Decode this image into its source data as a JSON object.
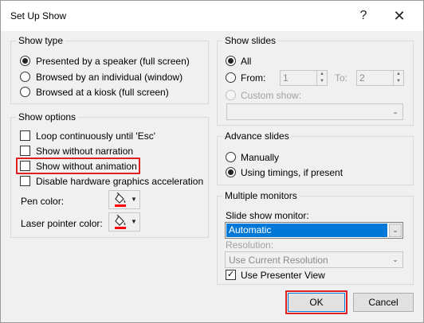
{
  "window": {
    "title": "Set Up Show",
    "help_glyph": "?",
    "close_glyph": "✕"
  },
  "show_type": {
    "title": "Show type",
    "options": [
      {
        "label": "Presented by a speaker (full screen)",
        "selected": true
      },
      {
        "label": "Browsed by an individual (window)",
        "selected": false
      },
      {
        "label": "Browsed at a kiosk (full screen)",
        "selected": false
      }
    ]
  },
  "show_options": {
    "title": "Show options",
    "checkboxes": [
      {
        "label": "Loop continuously until 'Esc'",
        "checked": false
      },
      {
        "label": "Show without narration",
        "checked": false
      },
      {
        "label": "Show without animation",
        "checked": false,
        "highlighted": true
      },
      {
        "label": "Disable hardware graphics acceleration",
        "checked": false
      }
    ],
    "pen_color_label": "Pen color:",
    "laser_pointer_label": "Laser pointer color:",
    "pen_color": "#ff0000",
    "laser_color": "#ff0000",
    "color_icon": "paint-bucket-icon"
  },
  "show_slides": {
    "title": "Show slides",
    "all_label": "All",
    "from_label": "From:",
    "to_label": "To:",
    "from_value": "1",
    "to_value": "2",
    "custom_label": "Custom show:",
    "custom_value": ""
  },
  "advance_slides": {
    "title": "Advance slides",
    "manually_label": "Manually",
    "timings_label": "Using timings, if present",
    "selected": "timings"
  },
  "monitors": {
    "title": "Multiple monitors",
    "monitor_label": "Slide show monitor:",
    "monitor_value": "Automatic",
    "resolution_label": "Resolution:",
    "resolution_value": "Use Current Resolution",
    "presenter_view_label": "Use Presenter View",
    "presenter_view_checked": true
  },
  "buttons": {
    "ok": "OK",
    "cancel": "Cancel"
  },
  "colors": {
    "accent": "#0078d7",
    "highlight": "#e02020"
  }
}
